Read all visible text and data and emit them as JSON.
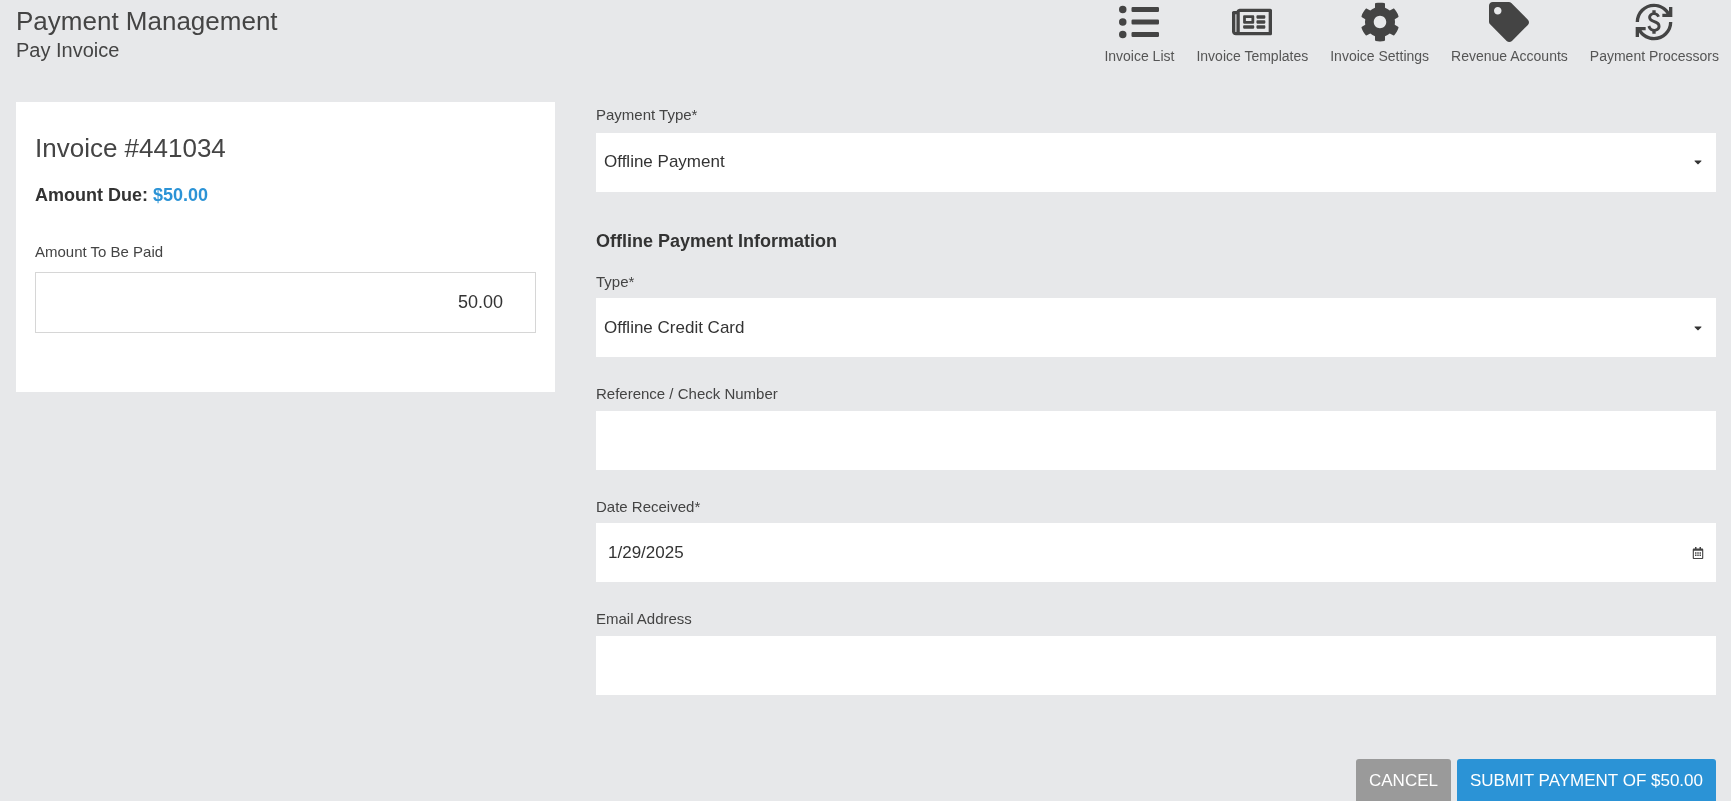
{
  "header": {
    "title": "Payment Management",
    "subtitle": "Pay Invoice"
  },
  "toolbar": [
    {
      "kind": "list",
      "label": "Invoice List"
    },
    {
      "kind": "template",
      "label": "Invoice Templates"
    },
    {
      "kind": "settings",
      "label": "Invoice Settings"
    },
    {
      "kind": "tag",
      "label": "Revenue Accounts"
    },
    {
      "kind": "exchange",
      "label": "Payment Processors"
    }
  ],
  "invoice": {
    "title": "Invoice #441034",
    "amount_due_label": "Amount Due:",
    "amount_due": "$50.00",
    "amount_label": "Amount To Be Paid",
    "amount_value": "50.00"
  },
  "payment_type": {
    "label": "Payment Type*",
    "value": "Offline Payment"
  },
  "section_title": "Offline Payment Information",
  "fields": [
    {
      "kind": "select",
      "label": "Type*",
      "value": "Offline Credit Card"
    },
    {
      "kind": "text",
      "label": "Reference / Check Number"
    },
    {
      "kind": "date",
      "label": "Date Received*",
      "value": "1/29/2025"
    },
    {
      "kind": "text",
      "label": "Email Address"
    }
  ],
  "buttons": [
    {
      "kind": "secondary",
      "label": "CANCEL"
    },
    {
      "kind": "primary",
      "label": "SUBMIT PAYMENT OF $50.00"
    }
  ]
}
